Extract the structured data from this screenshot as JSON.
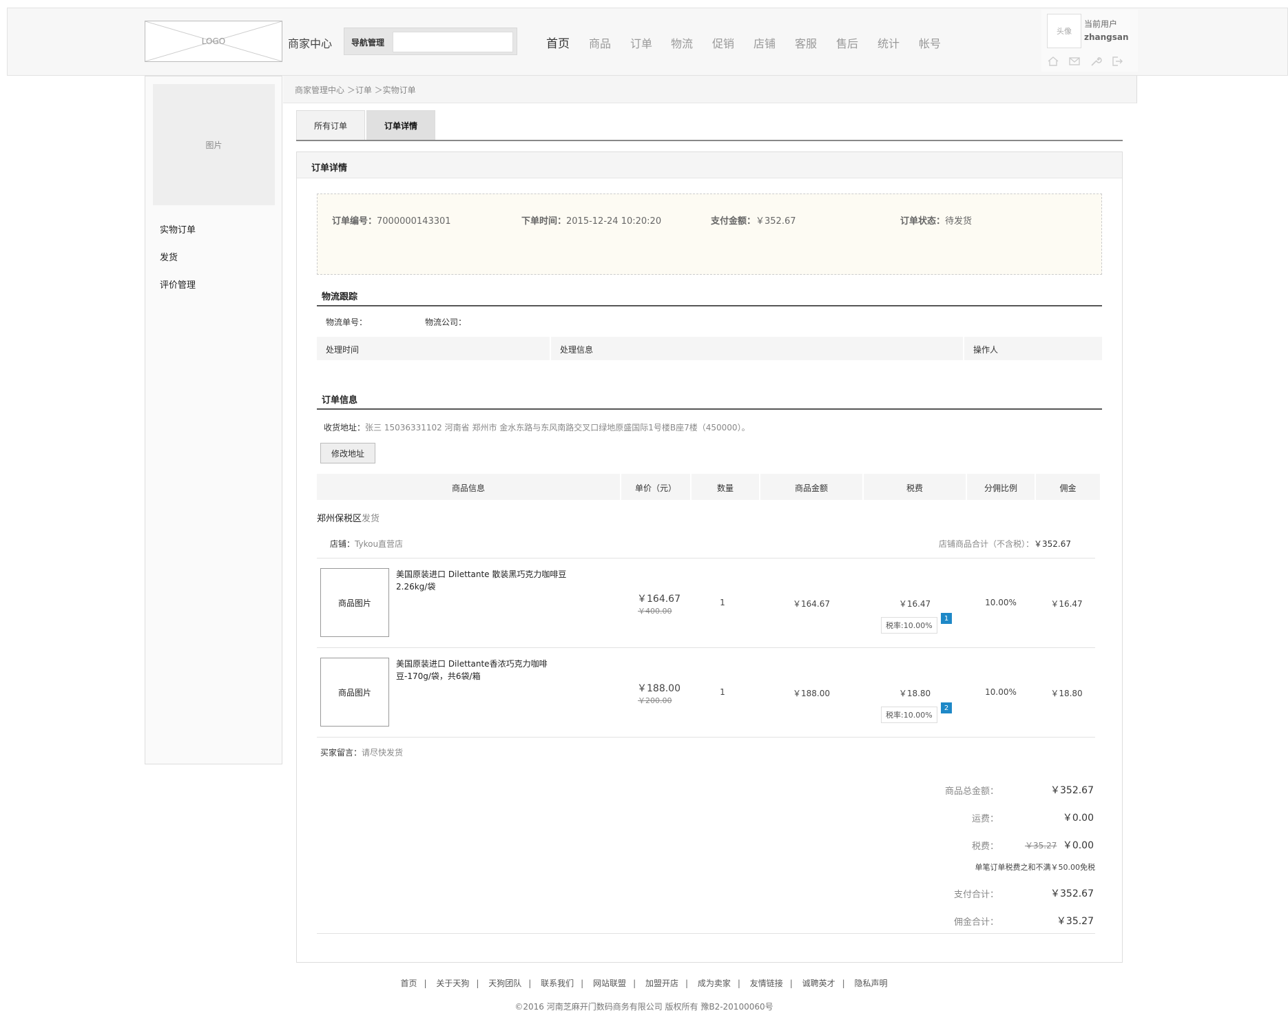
{
  "header": {
    "logo_text": "LOGO",
    "site_title": "商家中心",
    "nav_mgmt_label": "导航管理",
    "nav_mgmt_value": "",
    "nav": [
      "首页",
      "商品",
      "订单",
      "物流",
      "促销",
      "店铺",
      "客服",
      "售后",
      "统计",
      "帐号"
    ],
    "active_nav": "首页",
    "avatar_label": "头像",
    "current_user_label": "当前用户",
    "username": "zhangsan",
    "user_icons": [
      "home-icon",
      "mail-icon",
      "wrench-icon",
      "logout-icon"
    ]
  },
  "sidebar": {
    "image_label": "图片",
    "items": [
      "实物订单",
      "发货",
      "评价管理"
    ]
  },
  "breadcrumb": "商家管理中心 ＞订单 ＞实物订单",
  "tabs": [
    "所有订单",
    "订单详情"
  ],
  "panel_title": "订单详情",
  "summary": {
    "order_no_label": "订单编号：",
    "order_no": "7000000143301",
    "order_time_label": "下单时间：",
    "order_time": "2015-12-24  10:20:20",
    "pay_label": "支付金额：",
    "pay": "￥352.67",
    "status_label": "订单状态：",
    "status": "待发货"
  },
  "logistics": {
    "title": "物流跟踪",
    "waybill_label": "物流单号：",
    "company_label": "物流公司：",
    "columns": [
      "处理时间",
      "处理信息",
      "操作人"
    ]
  },
  "order_info": {
    "title": "订单信息",
    "address_label": "收货地址：",
    "address": "张三   15036331102   河南省  郑州市  金水东路与东风南路交叉口绿地原盛国际1号楼B座7楼（450000）。",
    "edit_button": "修改地址",
    "columns": [
      "商品信息",
      "单价（元）",
      "数量",
      "商品金额",
      "税费",
      "分佣比例",
      "佣金"
    ],
    "warehouse": "郑州保税区",
    "warehouse_suffix": "发货",
    "shop_label": "店铺：",
    "shop": "Tykou直营店",
    "shop_total_label": "店铺商品合计（不含税）：",
    "shop_total": "￥352.67"
  },
  "items": [
    {
      "image_label": "商品图片",
      "name": "美国原装进口 Dilettante 散装黑巧克力咖啡豆2.26kg/袋",
      "price": "￥164.67",
      "old_price": "￥400.00",
      "qty": "1",
      "amount": "￥164.67",
      "tax": "￥16.47",
      "tax_rate": "税率:10.00%",
      "badge": "1",
      "ratio": "10.00%",
      "commission": "￥16.47"
    },
    {
      "image_label": "商品图片",
      "name": "美国原装进口 Dilettante香浓巧克力咖啡豆-170g/袋，共6袋/箱",
      "price": "￥188.00",
      "old_price": "￥200.00",
      "qty": "1",
      "amount": "￥188.00",
      "tax": "￥18.80",
      "tax_rate": "税率:10.00%",
      "badge": "2",
      "ratio": "10.00%",
      "commission": "￥18.80"
    }
  ],
  "buyer_note_label": "买家留言：",
  "buyer_note": "请尽快发货",
  "totals": {
    "goods_label": "商品总金额：",
    "goods": "￥352.67",
    "shipping_label": "运费：",
    "shipping": "￥0.00",
    "tax_label": "税费：",
    "tax_old": "￥35.27",
    "tax": "￥0.00",
    "tax_note": "单笔订单税费之和不满￥50.00免税",
    "pay_label": "支付合计：",
    "pay": "￥352.67",
    "commission_label": "佣金合计：",
    "commission": "￥35.27"
  },
  "footer": {
    "links": [
      "首页",
      "关于天狗",
      "天狗团队",
      "联系我们",
      "网站联盟",
      "加盟开店",
      "成为卖家",
      "友情链接",
      "诚聘英才",
      "隐私声明"
    ],
    "separator": "|",
    "copyright": "©2016 河南芝麻开门数码商务有限公司 版权所有 豫B2-20100060号"
  }
}
